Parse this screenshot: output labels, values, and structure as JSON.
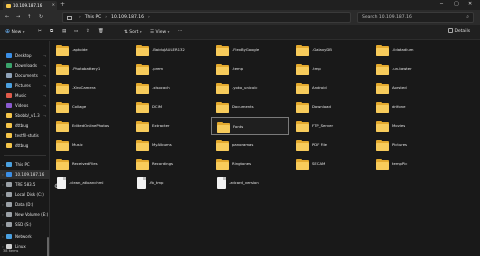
{
  "tab": {
    "title": "10.109.187.16"
  },
  "address": {
    "root": "This PC",
    "path": "10.109.187.16"
  },
  "search": {
    "placeholder": "Search 10.109.187.16"
  },
  "toolbar": {
    "new_label": "New",
    "sort_label": "Sort",
    "view_label": "View",
    "details_label": "Details"
  },
  "sidebar": {
    "pinned": [
      {
        "label": "Desktop",
        "color": "#3a8ee6"
      },
      {
        "label": "Downloads",
        "color": "#3aa36b"
      },
      {
        "label": "Documents",
        "color": "#8fa2b8"
      },
      {
        "label": "Pictures",
        "color": "#4aa0e0"
      },
      {
        "label": "Music",
        "color": "#e05a4a"
      },
      {
        "label": "Videos",
        "color": "#8a5ad0"
      },
      {
        "label": "Sbobb/_v1.3",
        "color": "#f4c54a"
      },
      {
        "label": "dttbug",
        "color": "#f4c54a"
      },
      {
        "label": "testfil-stutis",
        "color": "#f4c54a"
      },
      {
        "label": "dttbug",
        "color": "#f4c54a"
      }
    ],
    "this_pc": "This PC",
    "drives": [
      {
        "label": "10.109.187.16",
        "color": "#3a8ee6"
      },
      {
        "label": "TRE 583.5",
        "color": "#9aa0a6"
      },
      {
        "label": "Local Disk (C:)",
        "color": "#9aa0a6"
      },
      {
        "label": "Data (D:)",
        "color": "#9aa0a6"
      },
      {
        "label": "New Volume (E:)",
        "color": "#9aa0a6"
      },
      {
        "label": "SSD (S:)",
        "color": "#9aa0a6"
      }
    ],
    "network": "Network",
    "linux": "Linux"
  },
  "status": {
    "count": "38 items"
  },
  "items": [
    {
      "label": ".aptoide",
      "type": "folder"
    },
    {
      "label": ".BaiduJAULER132",
      "type": "folder"
    },
    {
      "label": ".FlexByGoogle",
      "type": "folder"
    },
    {
      "label": ".GalaxyDB",
      "type": "folder"
    },
    {
      "label": ".ildatadium",
      "type": "folder"
    },
    {
      "label": ".Photobattery1",
      "type": "folder"
    },
    {
      "label": ".prem",
      "type": "folder"
    },
    {
      "label": ".temp",
      "type": "folder"
    },
    {
      "label": ".tmp",
      "type": "folder"
    },
    {
      "label": ".un-tawter",
      "type": "folder"
    },
    {
      "label": ".XiroCamera",
      "type": "folder"
    },
    {
      "label": ".xlsocach",
      "type": "folder"
    },
    {
      "label": ".yoko_unicolc",
      "type": "folder"
    },
    {
      "label": "Android",
      "type": "folder"
    },
    {
      "label": "Aorsted",
      "type": "folder"
    },
    {
      "label": "Collage",
      "type": "folder"
    },
    {
      "label": "DCIM",
      "type": "folder"
    },
    {
      "label": "Documents",
      "type": "folder"
    },
    {
      "label": "Download",
      "type": "folder"
    },
    {
      "label": "drifone",
      "type": "folder"
    },
    {
      "label": "EditedOnlinePhotos",
      "type": "folder"
    },
    {
      "label": "Extracter",
      "type": "folder"
    },
    {
      "label": "Fonts",
      "type": "folder"
    },
    {
      "label": "FTP_Server",
      "type": "folder"
    },
    {
      "label": "Movies",
      "type": "folder"
    },
    {
      "label": "Music",
      "type": "folder"
    },
    {
      "label": "MyAlbums",
      "type": "folder"
    },
    {
      "label": "panoramas",
      "type": "folder"
    },
    {
      "label": "PDF File",
      "type": "folder"
    },
    {
      "label": "Pictures",
      "type": "folder"
    },
    {
      "label": "ReceivedFiles",
      "type": "folder"
    },
    {
      "label": "Recordings",
      "type": "folder"
    },
    {
      "label": "Ringtones",
      "type": "folder"
    },
    {
      "label": "SECAM",
      "type": "folder"
    },
    {
      "label": "tempPic",
      "type": "folder"
    },
    {
      "label": ".clean_atloanchml",
      "type": "settings"
    },
    {
      "label": ".fb_tmp",
      "type": "file"
    },
    {
      "label": ".zdcard_version",
      "type": "file"
    }
  ]
}
